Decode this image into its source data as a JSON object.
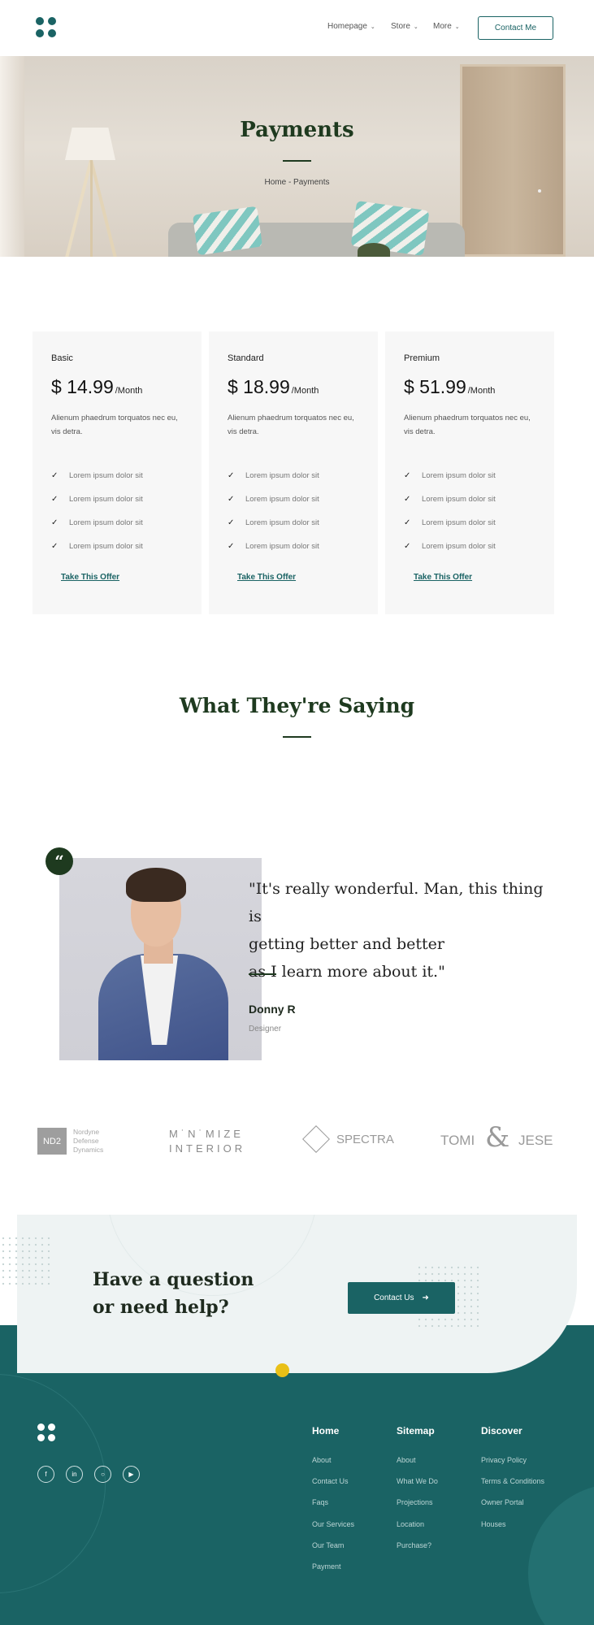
{
  "header": {
    "nav": [
      {
        "label": "Homepage"
      },
      {
        "label": "Store"
      },
      {
        "label": "More"
      }
    ],
    "contact_label": "Contact Me"
  },
  "hero": {
    "title": "Payments",
    "breadcrumb": "Home - Payments"
  },
  "pricing": [
    {
      "plan": "Basic",
      "price": "$ 14.99",
      "period": "/Month",
      "description": "Alienum phaedrum torquatos nec eu, vis detra.",
      "features": [
        "Lorem ipsum dolor sit",
        "Lorem ipsum dolor sit",
        "Lorem ipsum dolor sit",
        "Lorem ipsum dolor sit"
      ],
      "cta": "Take This Offer"
    },
    {
      "plan": "Standard",
      "price": "$ 18.99",
      "period": "/Month",
      "description": "Alienum phaedrum torquatos nec eu, vis detra.",
      "features": [
        "Lorem ipsum dolor sit",
        "Lorem ipsum dolor sit",
        "Lorem ipsum dolor sit",
        "Lorem ipsum dolor sit"
      ],
      "cta": "Take This Offer"
    },
    {
      "plan": "Premium",
      "price": "$ 51.99",
      "period": "/Month",
      "description": "Alienum phaedrum torquatos nec eu, vis detra.",
      "features": [
        "Lorem ipsum dolor sit",
        "Lorem ipsum dolor sit",
        "Lorem ipsum dolor sit",
        "Lorem ipsum dolor sit"
      ],
      "cta": "Take This Offer"
    }
  ],
  "testimonials": {
    "title": "What They're Saying",
    "quote_mark": "“",
    "quote_lines": [
      "\"It's really wonderful. Man, this thing is",
      "getting better and better",
      "as I learn more about it.\""
    ],
    "name": "Donny R",
    "role": "Designer"
  },
  "brands": {
    "nd2_mark": "ND2",
    "nd2_lines": [
      "Nordyne",
      "Defense",
      "Dynamics"
    ],
    "minimize_lines": [
      "M˙N˙MIZE",
      "INTERIOR"
    ],
    "spectra": "SPECTRA",
    "tomi": "TOMI",
    "amp": "&",
    "jese": "JESE"
  },
  "cta": {
    "title_lines": [
      "Have a question",
      "or need help?"
    ],
    "button_label": "Contact Us",
    "button_icon": "arrow-right-icon"
  },
  "footer": {
    "social": [
      {
        "icon": "facebook-icon",
        "glyph": "f"
      },
      {
        "icon": "linkedin-icon",
        "glyph": "in"
      },
      {
        "icon": "instagram-icon",
        "glyph": "○"
      },
      {
        "icon": "youtube-icon",
        "glyph": "▶"
      }
    ],
    "columns": [
      {
        "title": "Home",
        "links": [
          "About",
          "Contact Us",
          "Faqs",
          "Our Services",
          "Our Team",
          "Payment"
        ]
      },
      {
        "title": "Sitemap",
        "links": [
          "About",
          "What We Do",
          "Projections",
          "Location",
          "Purchase?"
        ]
      },
      {
        "title": "Discover",
        "links": [
          "Privacy Policy",
          "Terms & Conditions",
          "Owner Portal",
          "Houses"
        ]
      }
    ]
  },
  "colors": {
    "brand": "#1a6364",
    "heading": "#1e3a1f",
    "accent_dot": "#e9c017",
    "card_bg": "#f7f7f7",
    "cta_bg": "#eef3f3"
  }
}
